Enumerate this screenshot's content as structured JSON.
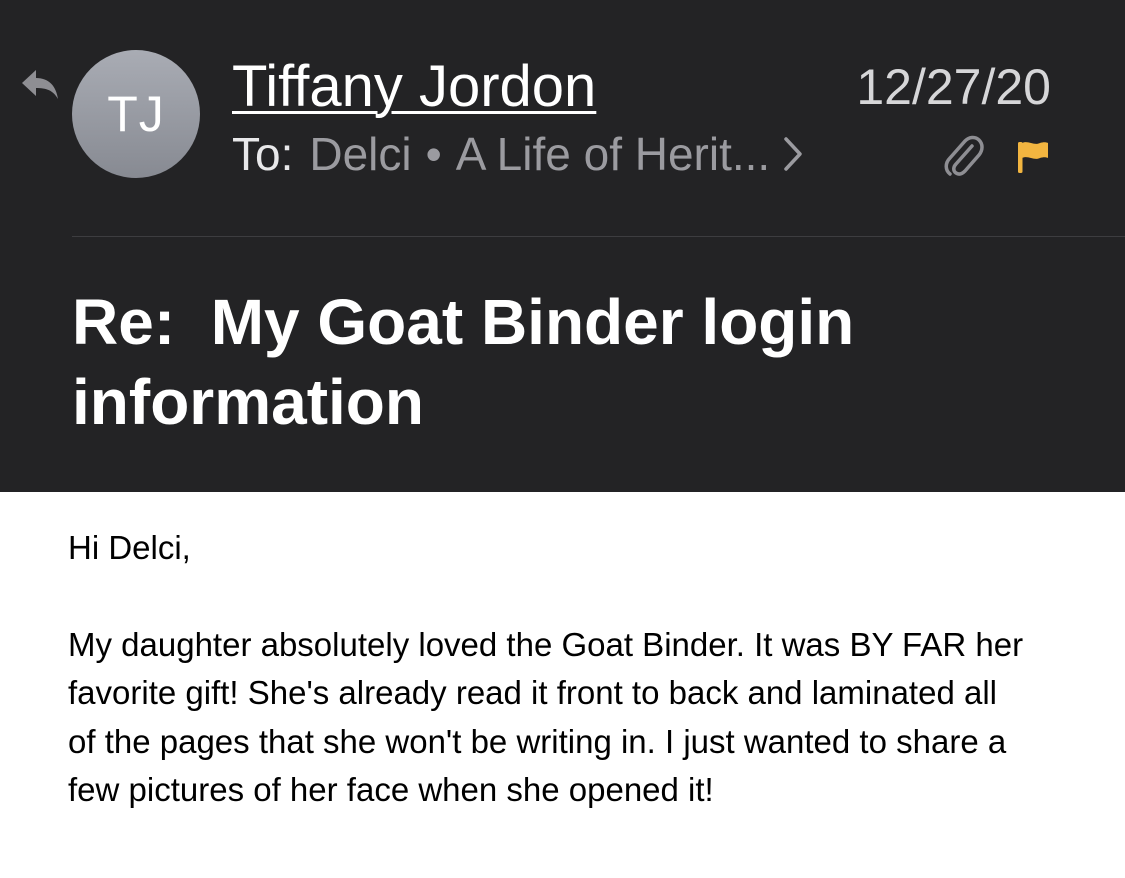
{
  "sender": {
    "initials": "TJ",
    "name": "Tiffany Jordon"
  },
  "date": "12/27/20",
  "recipients": {
    "label": "To:",
    "items": [
      "Delci",
      "A Life of Herit..."
    ]
  },
  "subject": "Re:  My Goat Binder login information",
  "body": {
    "greeting": "Hi Delci,",
    "paragraph": "My daughter absolutely loved the Goat Binder. It was BY FAR her favorite gift! She's already read it front to back and laminated all of the pages that she won't be writing in. I just wanted to share a few pictures of her face when she opened it!"
  },
  "icons": {
    "reply": "reply-icon",
    "chevron": "chevron-right-icon",
    "attachment": "paperclip-icon",
    "flag": "flag-icon"
  },
  "colors": {
    "header_background": "#232325",
    "flag": "#f2b540",
    "muted_text": "#9b9ba0"
  }
}
